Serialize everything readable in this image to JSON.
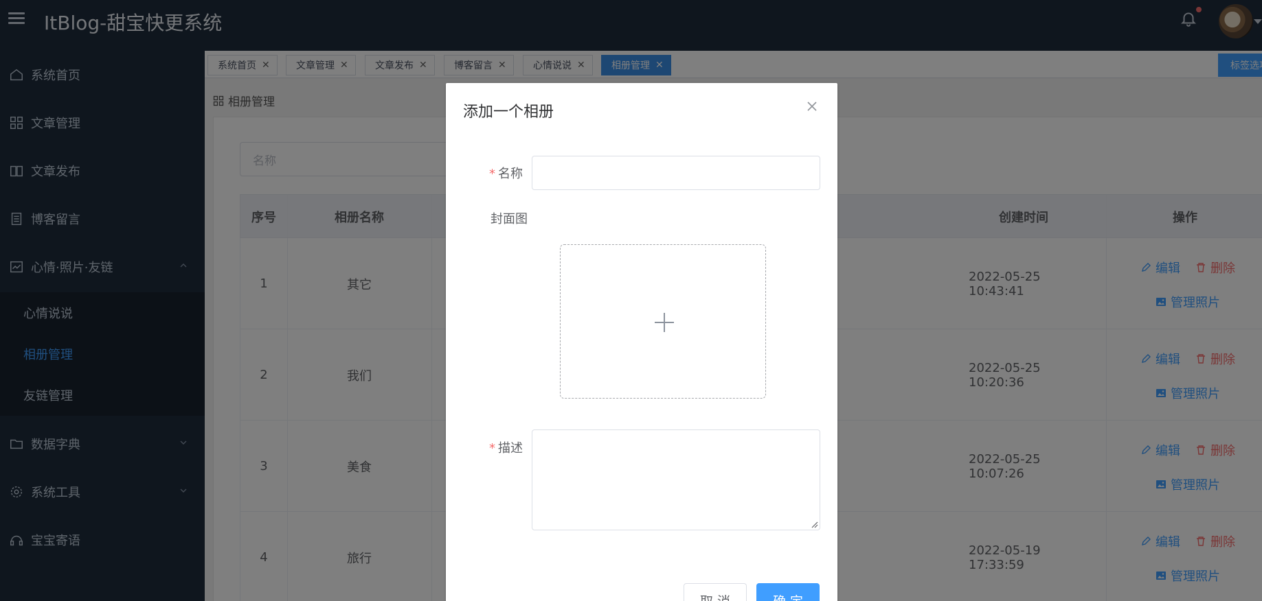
{
  "header": {
    "brand": "ItBlog-甜宝快更系统"
  },
  "sidebar": {
    "items": [
      {
        "label": "系统首页",
        "icon": "home-icon"
      },
      {
        "label": "文章管理",
        "icon": "grid-icon"
      },
      {
        "label": "文章发布",
        "icon": "book-icon"
      },
      {
        "label": "博客留言",
        "icon": "document-icon"
      },
      {
        "label": "心情·照片·友链",
        "icon": "chart-icon"
      },
      {
        "label": "数据字典",
        "icon": "folder-icon"
      },
      {
        "label": "系统工具",
        "icon": "gear-icon"
      },
      {
        "label": "宝宝寄语",
        "icon": "headset-icon"
      }
    ],
    "submenu": [
      {
        "label": "心情说说"
      },
      {
        "label": "相册管理"
      },
      {
        "label": "友链管理"
      }
    ]
  },
  "tags": {
    "items": [
      {
        "label": "系统首页"
      },
      {
        "label": "文章管理"
      },
      {
        "label": "文章发布"
      },
      {
        "label": "博客留言"
      },
      {
        "label": "心情说说"
      },
      {
        "label": "相册管理"
      }
    ],
    "select_label": "标签选项"
  },
  "breadcrumb": {
    "label": "相册管理"
  },
  "search": {
    "placeholder": "名称"
  },
  "table": {
    "headers": {
      "index": "序号",
      "name": "相册名称",
      "created": "创建时间",
      "ops": "操作"
    },
    "rows": [
      {
        "index": "1",
        "name": "其它",
        "created": "2022-05-25 10:43:41"
      },
      {
        "index": "2",
        "name": "我们",
        "created": "2022-05-25 10:20:36"
      },
      {
        "index": "3",
        "name": "美食",
        "created": "2022-05-25 10:07:26"
      },
      {
        "index": "4",
        "name": "旅行",
        "created": "2022-05-19 17:33:59"
      }
    ],
    "ops": {
      "edit": "编辑",
      "delete": "删除",
      "photos": "管理照片"
    }
  },
  "dialog": {
    "title": "添加一个相册",
    "name_label": "名称",
    "cover_label": "封面图",
    "desc_label": "描述",
    "cancel": "取 消",
    "confirm": "确 定"
  },
  "colors": {
    "accent": "#409eff",
    "danger": "#f56c6c",
    "sidebar_bg": "#1f2d3d"
  }
}
